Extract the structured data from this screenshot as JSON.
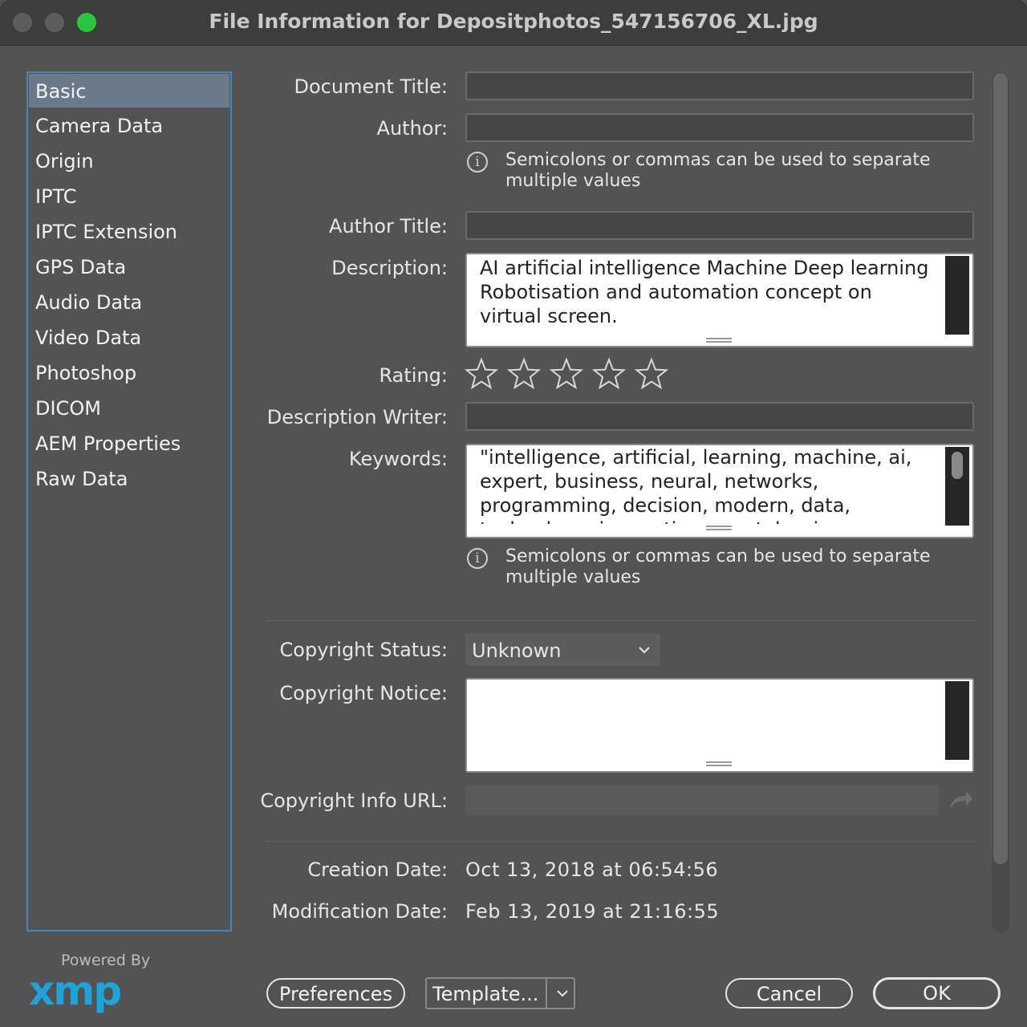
{
  "window": {
    "title": "File Information for Depositphotos_547156706_XL.jpg"
  },
  "sidebar": {
    "items": [
      {
        "label": "Basic",
        "selected": true
      },
      {
        "label": "Camera Data"
      },
      {
        "label": "Origin"
      },
      {
        "label": "IPTC"
      },
      {
        "label": "IPTC Extension"
      },
      {
        "label": "GPS Data"
      },
      {
        "label": "Audio Data"
      },
      {
        "label": "Video Data"
      },
      {
        "label": "Photoshop"
      },
      {
        "label": "DICOM"
      },
      {
        "label": "AEM Properties"
      },
      {
        "label": "Raw Data"
      }
    ],
    "powered_by": "Powered By",
    "logo_text": "xmp"
  },
  "form": {
    "document_title": {
      "label": "Document Title:",
      "value": ""
    },
    "author": {
      "label": "Author:",
      "value": ""
    },
    "author_hint": "Semicolons or commas can be used to separate multiple values",
    "author_title": {
      "label": "Author Title:",
      "value": ""
    },
    "description": {
      "label": "Description:",
      "value": "AI artificial intelligence Machine Deep learning Robotisation and automation concept on virtual screen."
    },
    "rating": {
      "label": "Rating:",
      "value": 0,
      "max": 5
    },
    "description_writer": {
      "label": "Description Writer:",
      "value": ""
    },
    "keywords": {
      "label": "Keywords:",
      "value": "\"intelligence, artificial, learning, machine, ai, expert, business, neural, networks, programming, decision, modern, data, technology, innovation, mental, science, concept"
    },
    "keywords_hint": "Semicolons or commas can be used to separate multiple values",
    "copyright_status": {
      "label": "Copyright Status:",
      "value": "Unknown"
    },
    "copyright_notice": {
      "label": "Copyright Notice:",
      "value": ""
    },
    "copyright_url": {
      "label": "Copyright Info URL:",
      "value": ""
    },
    "creation_date": {
      "label": "Creation Date:",
      "value": "Oct 13, 2018 at 06:54:56"
    },
    "modification_date": {
      "label": "Modification Date:",
      "value": "Feb 13, 2019 at 21:16:55"
    }
  },
  "buttons": {
    "preferences": "Preferences",
    "template": "Template...",
    "cancel": "Cancel",
    "ok": "OK"
  },
  "colors": {
    "background": "#535353",
    "accent": "#3b87cc",
    "close_button": "#5c5c5c",
    "zoom_button": "#2ac53f",
    "xmp_logo": "#1fa3d9"
  }
}
